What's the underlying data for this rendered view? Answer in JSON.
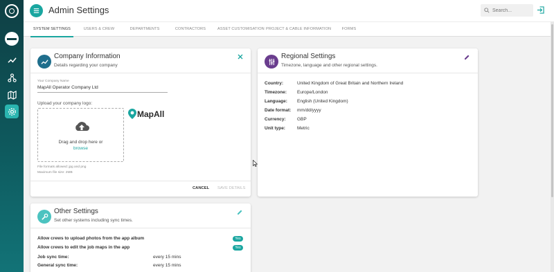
{
  "header": {
    "title": "Admin Settings",
    "search_placeholder": "Search..."
  },
  "tabs": [
    {
      "label": "SYSTEM SETTINGS",
      "active": true
    },
    {
      "label": "USERS & CREW"
    },
    {
      "label": "DEPARTMENTS"
    },
    {
      "label": "CONTRACTORS"
    },
    {
      "label": "ASSET CUSTOMISATION"
    },
    {
      "label": "PROJECT & CABLE INFORMATION"
    },
    {
      "label": "FORMS"
    }
  ],
  "company": {
    "title": "Company Information",
    "subtitle": "Details regarding your company",
    "name_label": "Your Company Name",
    "name_value": "MapAll Operator Company Ltd",
    "upload_label": "Upload your company logo:",
    "drop_text": "Drag and drop here or",
    "browse": "browse",
    "formats": "File formats allowed: jpg and png",
    "maxsize": "Maximum file size: 2MB",
    "logo_text": "MapAll",
    "cancel": "CANCEL",
    "save": "SAVE DETAILS"
  },
  "regional": {
    "title": "Regional Settings",
    "subtitle": "Timezone, language and other regional settings.",
    "rows": [
      {
        "label": "Country:",
        "value": "United Kingdom of Great Britain and Northern Ireland"
      },
      {
        "label": "Timezone:",
        "value": "Europe/London"
      },
      {
        "label": "Language:",
        "value": "English (United Kingdom)"
      },
      {
        "label": "Date format:",
        "value": "mm/dd/yyyy"
      },
      {
        "label": "Currency:",
        "value": "GBP"
      },
      {
        "label": "Unit type:",
        "value": "Metric"
      }
    ]
  },
  "other": {
    "title": "Other Settings",
    "subtitle": "Set other systems including sync times.",
    "rows": [
      {
        "label": "Allow crews to upload photos from the app album",
        "badge": "Yes"
      },
      {
        "label": "Allow crews to edit the job maps in the app",
        "badge": "Yes"
      },
      {
        "label": "Job sync time:",
        "value": "every 15 mins"
      },
      {
        "label": "General sync time:",
        "value": "every 15 mins"
      }
    ]
  },
  "colors": {
    "accent": "#1aa6a0",
    "regional_icon": "#6a3d8e",
    "company_icon": "#1f6e8c",
    "other_icon": "#4cc3c0"
  }
}
